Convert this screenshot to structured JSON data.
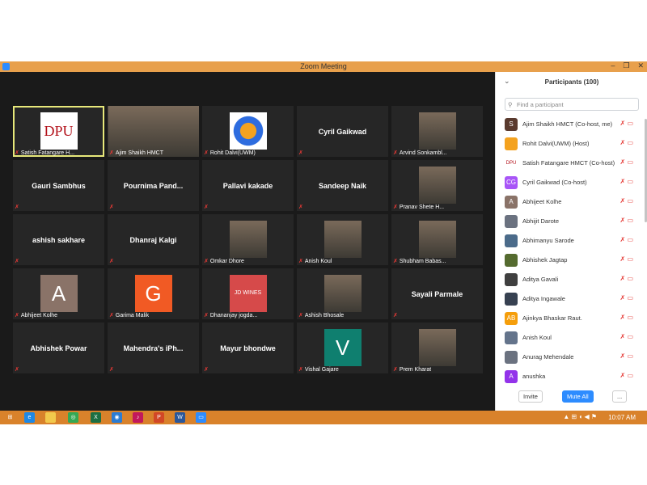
{
  "window": {
    "title": "Zoom Meeting",
    "controls": [
      "–",
      "❐",
      "✕"
    ]
  },
  "tiles": [
    {
      "label": "Satish Fatangare H...",
      "type": "image",
      "img": "dpu",
      "active": true
    },
    {
      "label": "Ajim Shaikh HMCT",
      "type": "image",
      "img": "person"
    },
    {
      "label": "Rohit Dalvi(UWM)",
      "type": "image",
      "img": "logo"
    },
    {
      "name": "Cyril Gaikwad",
      "label": ""
    },
    {
      "label": "Arvind Sonkambl...",
      "type": "image",
      "img": "person"
    },
    {
      "name": "Gauri Sambhus",
      "label": ""
    },
    {
      "name": "Pournima  Pand...",
      "label": ""
    },
    {
      "name": "Pallavi kakade",
      "label": ""
    },
    {
      "name": "Sandeep Naik",
      "label": ""
    },
    {
      "label": "Pranav Shete H...",
      "type": "image",
      "img": "person"
    },
    {
      "name": "ashish sakhare",
      "label": ""
    },
    {
      "name": "Dhanraj Kalgi",
      "label": ""
    },
    {
      "label": "Omkar Dhore",
      "type": "image",
      "img": "person"
    },
    {
      "label": "Anish Koul",
      "type": "image",
      "img": "person"
    },
    {
      "label": "Shubham Babas...",
      "type": "image",
      "img": "person"
    },
    {
      "label": "Abhijeet Kolhe",
      "type": "letter",
      "letter": "A",
      "color": "#8a7368"
    },
    {
      "label": "Garima Malik",
      "type": "letter",
      "letter": "G",
      "color": "#f15a24"
    },
    {
      "label": "Dhananjay jogda...",
      "type": "image",
      "img": "jdwines",
      "text": "JD WINES"
    },
    {
      "label": "Ashish Bhosale",
      "type": "image",
      "img": "person"
    },
    {
      "name": "Sayali Parmale",
      "label": ""
    },
    {
      "name": "Abhishek Powar",
      "label": ""
    },
    {
      "name": "Mahendra's  iPh...",
      "label": ""
    },
    {
      "name": "Mayur bhondwe",
      "label": ""
    },
    {
      "label": "Vishal Gajare",
      "type": "letter",
      "letter": "V",
      "color": "#0f7f6f"
    },
    {
      "label": "Prem Kharat",
      "type": "image",
      "img": "person"
    }
  ],
  "participants": {
    "title": "Participants (100)",
    "search_placeholder": "Find a participant",
    "list": [
      {
        "name": "Ajim Shaikh HMCT (Co-host, me)",
        "av": "S",
        "color": "#5a3a2e"
      },
      {
        "name": "Rohit Dalvi(UWM) (Host)",
        "av": "",
        "color": "#f4a21f"
      },
      {
        "name": "Satish Fatangare HMCT (Co-host)",
        "av": "DPU",
        "color": "#ffffff"
      },
      {
        "name": "Cyril Gaikwad (Co-host)",
        "av": "CG",
        "color": "#a855f7"
      },
      {
        "name": "Abhijeet Kolhe",
        "av": "A",
        "color": "#8a7368"
      },
      {
        "name": "Abhijit Darote",
        "av": "",
        "color": "#6b7280"
      },
      {
        "name": "Abhimanyu Sarode",
        "av": "",
        "color": "#4b6b8a"
      },
      {
        "name": "Abhishek Jagtap",
        "av": "",
        "color": "#556b2f"
      },
      {
        "name": "Aditya Gavali",
        "av": "",
        "color": "#3f3f3f"
      },
      {
        "name": "Aditya Ingawale",
        "av": "",
        "color": "#374151"
      },
      {
        "name": "Ajinkya Bhaskar Raut.",
        "av": "AB",
        "color": "#f59e0b"
      },
      {
        "name": "Anish Koul",
        "av": "",
        "color": "#64748b"
      },
      {
        "name": "Anurag Mehendale",
        "av": "",
        "color": "#6b7280"
      },
      {
        "name": "anushka",
        "av": "A",
        "color": "#9333ea"
      }
    ],
    "invite": "Invite",
    "mute_all": "Mute All",
    "more": "..."
  },
  "taskbar": {
    "clock": "10:07 AM",
    "tray": "▲ ⊞ ◖ ◀ ⚑"
  }
}
